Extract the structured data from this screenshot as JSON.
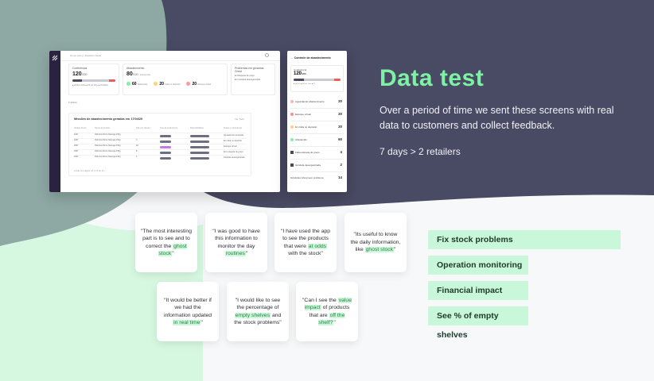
{
  "colors": {
    "hero_bg": "#494a63",
    "accent_green": "#7ef2a4",
    "tag_bg": "#c9f7d9",
    "highlight_text": "#2f7f4a"
  },
  "mockup": {
    "breadcrumb": "Home Leroy  |  Relatório Geral",
    "card1": {
      "title": "Conferência",
      "value": "120",
      "suffix": "/200",
      "legend": "■ 40 Bem feitas   ■ 60 por fazer   ■ 20 falhas"
    },
    "card2": {
      "title": "Abastecimento",
      "value": "80",
      "suffix": "/100",
      "suffix2": "abastecido",
      "kpis": [
        {
          "value": "60",
          "label": "Abastecido"
        },
        {
          "value": "20",
          "label": "Falta no depósito"
        },
        {
          "value": "20",
          "label": "Estoque virtual"
        }
      ]
    },
    "card3": {
      "title": "Problemas em gôndolas Ghost",
      "items": [
        "■ 4  Etiqueta de preço",
        "■ 2  Gôndola desorganizada"
      ]
    },
    "filters": "≡  Filtros",
    "table": {
      "title": "Missões de abastecimento geradas em 17/04/20",
      "link": "Ver Tudo",
      "headers": [
        "Código Ghost",
        "Nome do produto",
        "Qtd. por Vender",
        "Tipo de conferência",
        "Disponibilidade",
        "Status e conferência"
      ],
      "rows": [
        {
          "code": "4097",
          "name": "Palmitos Ricos Manuga 150g",
          "qty": "",
          "status": "Aguardando reposição"
        },
        {
          "code": "4067",
          "name": "Palmitos Ricos Manuga 150g",
          "qty": "4",
          "status": "Em falta no depósito"
        },
        {
          "code": "4097",
          "name": "Palmitos Ricos Manuga 150g",
          "qty": "18",
          "status": "Estoque virtual"
        },
        {
          "code": "4067",
          "name": "Palmitos Ricos Manuga 150g",
          "qty": "8",
          "status": "Erro etiqueta de preço"
        },
        {
          "code": "4097",
          "name": "Palmitos Ricos Manuga 150g",
          "qty": "4",
          "status": "Gôndola desorganizada"
        }
      ],
      "pagination": "Linhas por página: 10 ▾     1-5 de 12      ‹     ›"
    }
  },
  "panel": {
    "header": "←  Controle de abastecimento",
    "card": {
      "title": "Conferência",
      "value": "120",
      "suffix": "/200",
      "legend": "■ 40 feitas  ■ 60 por fazer  ■ 20"
    },
    "rows": [
      {
        "label": "Aguardando abastecimento",
        "count": "20"
      },
      {
        "label": "Estoque virtual",
        "count": "20"
      },
      {
        "label": "Em falta no depósito",
        "count": "20"
      },
      {
        "label": "Abastecido",
        "count": "60"
      },
      {
        "label": "Falta etiqueta de preço",
        "count": "4"
      },
      {
        "label": "Gôndola desorganizada",
        "count": "2"
      },
      {
        "label": "Gôndolas Ghost sem problema",
        "count": "14"
      }
    ]
  },
  "hero": {
    "title": "Data test",
    "description": "Over a period of time we sent these screens with real data to customers and collect feedback.",
    "meta": "7 days > 2 retailers"
  },
  "quotes": [
    {
      "pre": "\"The most interesting part is to see and to correct the ",
      "hl": "ghost stock",
      "post": "\""
    },
    {
      "pre": "\"I was good to have this information to monitor the day ",
      "hl": "routines",
      "post": "\""
    },
    {
      "pre": "\"I have used the app to see the products that were ",
      "hl": "at odds",
      "post": " with the stock\""
    },
    {
      "pre": "\"Its useful to know the daily information, like ",
      "hl": "ghost stock",
      "post": "\""
    },
    {
      "pre": "\"It would be better if we had the information updated ",
      "hl": "in real time",
      "post": "\""
    },
    {
      "pre": "\"I would like to see the percentage of ",
      "hl": "empty shelves",
      "post": " and the stock problems\""
    },
    {
      "pre": "\"Can I see the ",
      "hl": "value impact",
      "post": " of products that are ",
      "hl2": "off the shelf?",
      "post2": "\""
    }
  ],
  "tags": [
    "Fix stock problems",
    "Operation monitoring",
    "Financial impact",
    "See % of empty shelves"
  ]
}
